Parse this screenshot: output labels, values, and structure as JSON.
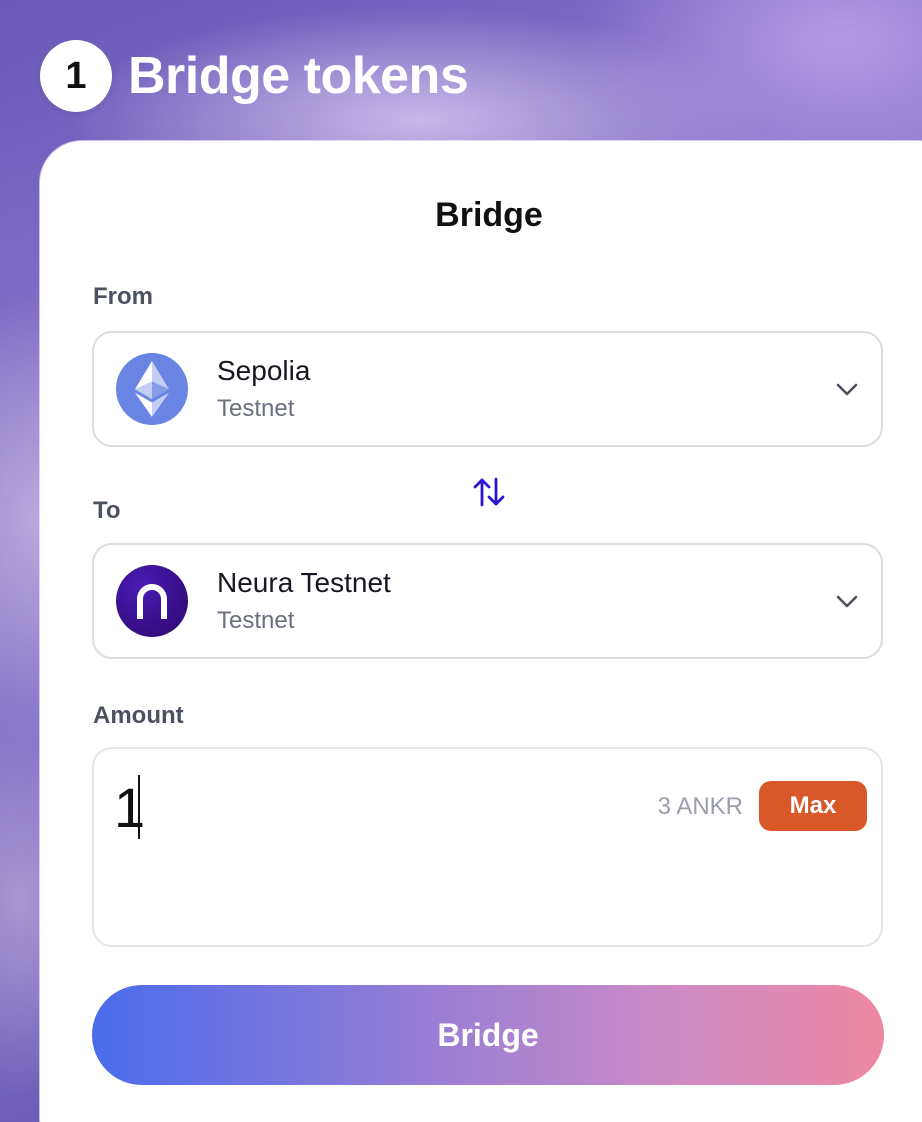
{
  "step": {
    "number": "1",
    "title": "Bridge tokens"
  },
  "card": {
    "title": "Bridge"
  },
  "from": {
    "label": "From",
    "chain_name": "Sepolia",
    "chain_type": "Testnet",
    "icon": "ethereum-logo-icon"
  },
  "swap": {
    "icon": "swap-arrows-icon"
  },
  "to": {
    "label": "To",
    "chain_name": "Neura Testnet",
    "chain_type": "Testnet",
    "icon": "neura-logo-icon"
  },
  "amount": {
    "label": "Amount",
    "value": "1",
    "balance": "3 ANKR",
    "max_label": "Max"
  },
  "bridge_button": {
    "label": "Bridge"
  },
  "colors": {
    "max_button": "#d8582a",
    "swap_icon": "#2a14d6",
    "bridge_gradient_start": "#4a6cec",
    "bridge_gradient_end": "#ee88a2"
  }
}
